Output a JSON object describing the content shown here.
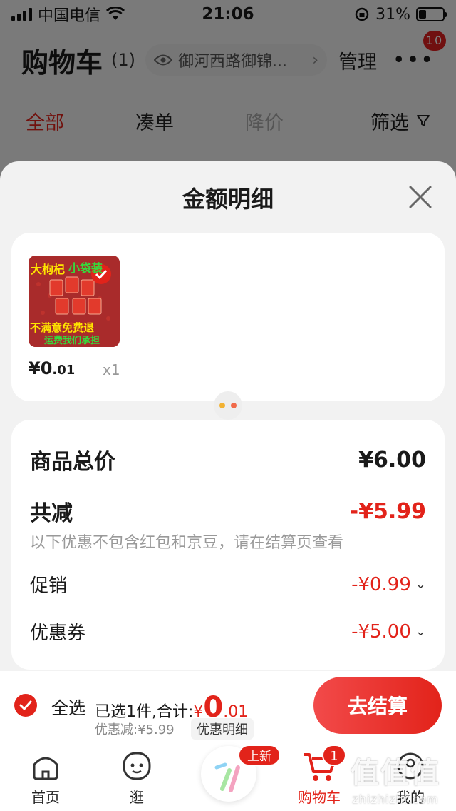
{
  "status_bar": {
    "carrier": "中国电信",
    "time": "21:06",
    "battery": "31%",
    "battery_level": 0.31
  },
  "cart": {
    "title": "购物车",
    "count": "(1)",
    "address": "御河西路御锦...",
    "manage": "管理",
    "more_badge": "10",
    "tabs": [
      "全部",
      "凑单",
      "降价"
    ],
    "filter": "筛选"
  },
  "sheet": {
    "title": "金额明细",
    "item": {
      "price_int": "¥0",
      "price_dec": ".01",
      "qty": "x1",
      "image_text_top": "大枸杞",
      "image_text_top2": "小袋装",
      "image_text_bottom": "不满意免费退",
      "image_text_bottom2": "运费我们承担"
    },
    "total_label": "商品总价",
    "total_value": "¥6.00",
    "reduce_label": "共减",
    "reduce_value": "-¥5.99",
    "note": "以下优惠不包含红包和京豆，请在结算页查看",
    "promo_label": "促销",
    "promo_value": "-¥0.99",
    "coupon_label": "优惠券",
    "coupon_value": "-¥5.00"
  },
  "checkout": {
    "select_all": "全选",
    "selected_text": "已选1件,合计:",
    "currency": "¥",
    "amount_int": "0",
    "amount_dec": ".01",
    "discount": "优惠减:¥5.99",
    "discount_detail": "优惠明细",
    "pay": "去结算"
  },
  "tabbar": {
    "home": "首页",
    "browse": "逛",
    "new_badge": "上新",
    "cart": "购物车",
    "cart_badge": "1",
    "me": "我的"
  },
  "watermark": {
    "big": "值值值",
    "small": "zhizhizhi.com"
  },
  "colors": {
    "accent": "#e2231a",
    "overlay": "rgba(0,0,0,0.5)"
  }
}
